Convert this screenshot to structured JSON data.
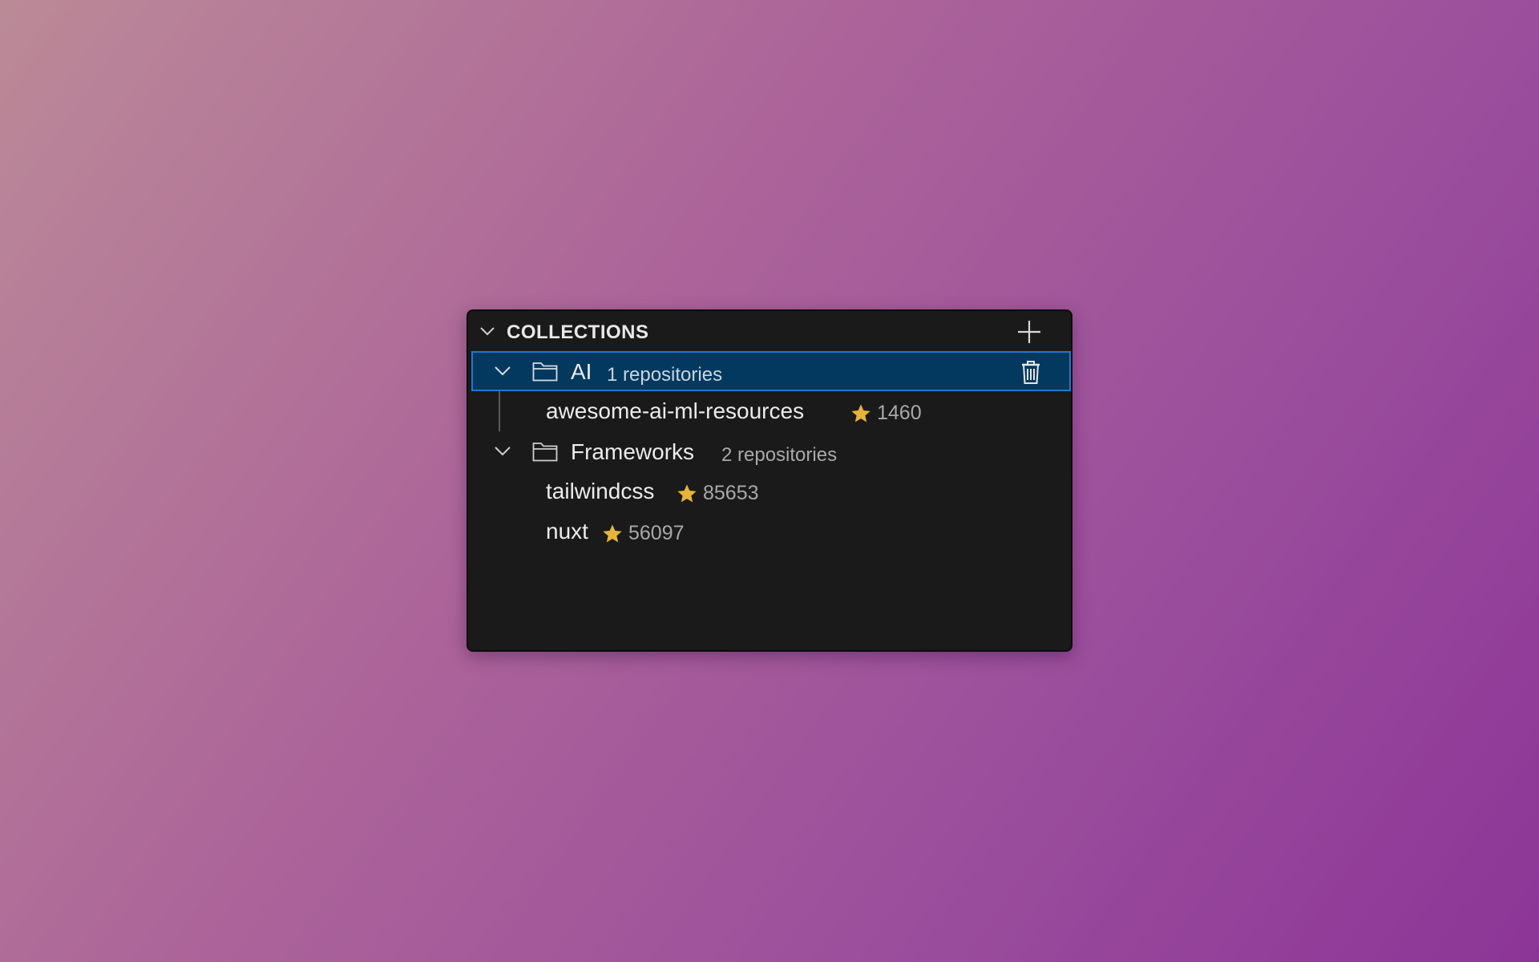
{
  "panel": {
    "title": "COLLECTIONS",
    "add_icon": "plus-icon",
    "collapse_icon": "chevron-down-icon"
  },
  "collections": [
    {
      "name": "AI",
      "count_label": "1 repositories",
      "selected": true,
      "icons": [
        "chevron-down-icon",
        "folder-icon",
        "trash-icon"
      ],
      "repos": [
        {
          "name": "awesome-ai-ml-resources",
          "stars": "1460"
        }
      ]
    },
    {
      "name": "Frameworks",
      "count_label": "2 repositories",
      "selected": false,
      "icons": [
        "chevron-down-icon",
        "folder-icon"
      ],
      "repos": [
        {
          "name": "tailwindcss",
          "stars": "85653"
        },
        {
          "name": "nuxt",
          "stars": "56097"
        }
      ]
    }
  ],
  "colors": {
    "panel_bg": "#1a1a1a",
    "selected_bg": "#03395e",
    "selected_border": "#1e78d0",
    "star": "#e6b43a"
  }
}
